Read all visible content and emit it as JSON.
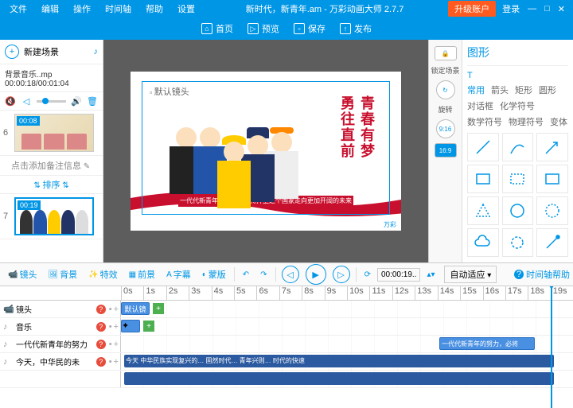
{
  "app": {
    "title": "新时代，新青年.am - 万彩动画大师 2.7.7",
    "upgrade": "升级账户",
    "login": "登录"
  },
  "menu": [
    "文件",
    "编辑",
    "操作",
    "时间轴",
    "帮助",
    "设置"
  ],
  "toolbar": {
    "home": "首页",
    "preview": "预览",
    "save": "保存",
    "publish": "发布"
  },
  "left": {
    "newscene": "新建场景",
    "bgmusic": "背景音乐..mp 00:00:18/00:01:04",
    "addnote": "点击添加备注信息",
    "sort": "排序",
    "thumbs": [
      {
        "num": "6",
        "badge": "00:08"
      },
      {
        "num": "7",
        "badge": "00:19"
      }
    ]
  },
  "canvas": {
    "lenslabel": "默认镜头",
    "vtext1": "青春有梦",
    "vtext2": "勇往直前",
    "caption": "一代代新青年的努力，必将捍卫这个国家走向更加开阔的未来"
  },
  "rpanel": {
    "lock": "锁定场景",
    "rotate": "旋转",
    "ratio1": "9:16",
    "ratio2": "16:9"
  },
  "shapes": {
    "title": "图形",
    "cats": [
      "常用",
      "箭头",
      "矩形",
      "圆形",
      "对话框",
      "化学符号",
      "数学符号",
      "物理符号",
      "变体"
    ]
  },
  "midbar": {
    "tabs": [
      "镜头",
      "背景",
      "特效",
      "前景",
      "字幕",
      "蒙版"
    ],
    "time": "00:00:19..",
    "auto": "自动适应",
    "help": "时间轴帮助"
  },
  "timeline": {
    "ticks": [
      "0s",
      "1s",
      "2s",
      "3s",
      "4s",
      "5s",
      "6s",
      "7s",
      "8s",
      "9s",
      "10s",
      "11s",
      "12s",
      "13s",
      "14s",
      "15s",
      "16s",
      "17s",
      "18s",
      "19s"
    ],
    "tracks": [
      {
        "icon": "📹",
        "name": "镜头",
        "lens": "默认镜"
      },
      {
        "icon": "♪",
        "name": "音乐"
      },
      {
        "icon": "♪",
        "name": "一代代新青年的努力"
      },
      {
        "icon": "♪",
        "name": "今天，中华民的未"
      }
    ]
  }
}
